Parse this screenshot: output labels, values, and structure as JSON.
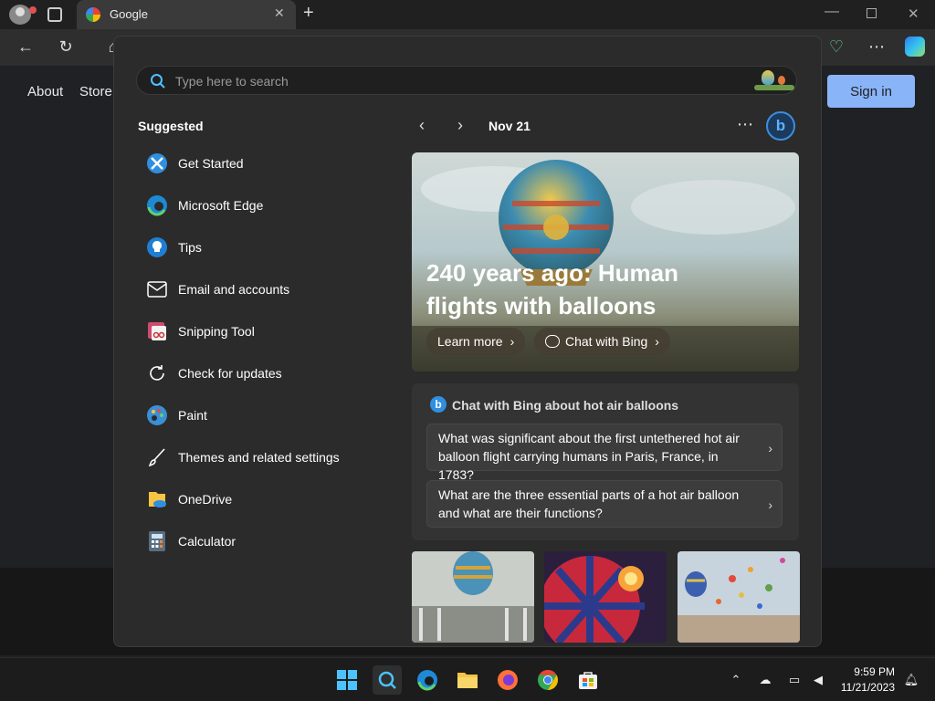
{
  "browser": {
    "tab_title": "Google",
    "nav_links": [
      "About",
      "Store"
    ],
    "signin_label": "Sign in"
  },
  "search": {
    "placeholder": "Type here to search"
  },
  "suggested": {
    "title": "Suggested",
    "items": [
      {
        "label": "Get Started",
        "icon": "get-started-icon"
      },
      {
        "label": "Microsoft Edge",
        "icon": "edge-icon"
      },
      {
        "label": "Tips",
        "icon": "tips-icon"
      },
      {
        "label": "Email and accounts",
        "icon": "mail-icon"
      },
      {
        "label": "Snipping Tool",
        "icon": "snipping-tool-icon"
      },
      {
        "label": "Check for updates",
        "icon": "refresh-icon"
      },
      {
        "label": "Paint",
        "icon": "paint-icon"
      },
      {
        "label": "Themes and related settings",
        "icon": "brush-icon"
      },
      {
        "label": "OneDrive",
        "icon": "onedrive-icon"
      },
      {
        "label": "Calculator",
        "icon": "calculator-icon"
      }
    ]
  },
  "highlights": {
    "date": "Nov 21",
    "hero_title": "240 years ago: Human flights with balloons",
    "learn_more": "Learn more",
    "chat_with_bing": "Chat with Bing"
  },
  "chat": {
    "title": "Chat with Bing about hot air balloons",
    "questions": [
      "What was significant about the first untethered hot air balloon flight carrying humans in Paris, France, in 1783?",
      "What are the three essential parts of a hot air balloon and what are their functions?"
    ]
  },
  "taskbar": {
    "time": "9:59 PM",
    "date": "11/21/2023"
  },
  "colors": {
    "accent": "#8ab4f8",
    "panel_bg": "#2b2b2b",
    "taskbar_bg": "#1c1c1c"
  }
}
